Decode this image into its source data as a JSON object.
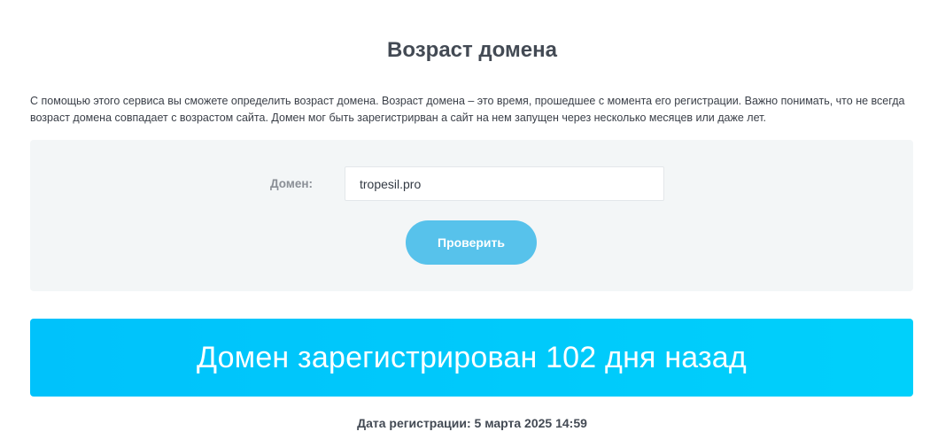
{
  "page": {
    "title": "Возраст домена",
    "description": "С помощью этого сервиса вы сможете определить возраст домена. Возраст домена – это время, прошедшее с момента его регистрации. Важно понимать, что не всегда возраст домена совпадает с возрастом сайта. Домен мог быть зарегистрирван а сайт на нем запущен через несколько месяцев или даже лет."
  },
  "form": {
    "domain_label": "Домен:",
    "domain_value": "tropesil.pro",
    "submit_label": "Проверить"
  },
  "result": {
    "banner_text": "Домен зарегистрирован 102 дня назад",
    "registration_date": "Дата регистрации: 5 марта 2025 14:59"
  },
  "colors": {
    "accent": "#00c8fb",
    "button": "#57c2eb",
    "panel_bg": "#f3f6f7"
  }
}
